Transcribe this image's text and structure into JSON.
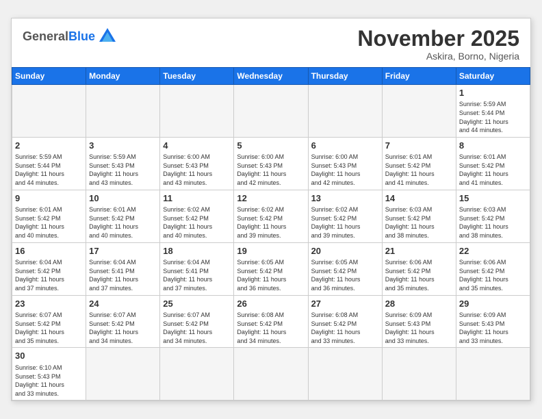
{
  "header": {
    "logo_general": "General",
    "logo_blue": "Blue",
    "month_title": "November 2025",
    "location": "Askira, Borno, Nigeria"
  },
  "weekdays": [
    "Sunday",
    "Monday",
    "Tuesday",
    "Wednesday",
    "Thursday",
    "Friday",
    "Saturday"
  ],
  "weeks": [
    [
      {
        "day": "",
        "info": ""
      },
      {
        "day": "",
        "info": ""
      },
      {
        "day": "",
        "info": ""
      },
      {
        "day": "",
        "info": ""
      },
      {
        "day": "",
        "info": ""
      },
      {
        "day": "",
        "info": ""
      },
      {
        "day": "1",
        "info": "Sunrise: 5:59 AM\nSunset: 5:44 PM\nDaylight: 11 hours\nand 44 minutes."
      }
    ],
    [
      {
        "day": "2",
        "info": "Sunrise: 5:59 AM\nSunset: 5:44 PM\nDaylight: 11 hours\nand 44 minutes."
      },
      {
        "day": "3",
        "info": "Sunrise: 5:59 AM\nSunset: 5:43 PM\nDaylight: 11 hours\nand 43 minutes."
      },
      {
        "day": "4",
        "info": "Sunrise: 6:00 AM\nSunset: 5:43 PM\nDaylight: 11 hours\nand 43 minutes."
      },
      {
        "day": "5",
        "info": "Sunrise: 6:00 AM\nSunset: 5:43 PM\nDaylight: 11 hours\nand 42 minutes."
      },
      {
        "day": "6",
        "info": "Sunrise: 6:00 AM\nSunset: 5:43 PM\nDaylight: 11 hours\nand 42 minutes."
      },
      {
        "day": "7",
        "info": "Sunrise: 6:01 AM\nSunset: 5:42 PM\nDaylight: 11 hours\nand 41 minutes."
      },
      {
        "day": "8",
        "info": "Sunrise: 6:01 AM\nSunset: 5:42 PM\nDaylight: 11 hours\nand 41 minutes."
      }
    ],
    [
      {
        "day": "9",
        "info": "Sunrise: 6:01 AM\nSunset: 5:42 PM\nDaylight: 11 hours\nand 40 minutes."
      },
      {
        "day": "10",
        "info": "Sunrise: 6:01 AM\nSunset: 5:42 PM\nDaylight: 11 hours\nand 40 minutes."
      },
      {
        "day": "11",
        "info": "Sunrise: 6:02 AM\nSunset: 5:42 PM\nDaylight: 11 hours\nand 40 minutes."
      },
      {
        "day": "12",
        "info": "Sunrise: 6:02 AM\nSunset: 5:42 PM\nDaylight: 11 hours\nand 39 minutes."
      },
      {
        "day": "13",
        "info": "Sunrise: 6:02 AM\nSunset: 5:42 PM\nDaylight: 11 hours\nand 39 minutes."
      },
      {
        "day": "14",
        "info": "Sunrise: 6:03 AM\nSunset: 5:42 PM\nDaylight: 11 hours\nand 38 minutes."
      },
      {
        "day": "15",
        "info": "Sunrise: 6:03 AM\nSunset: 5:42 PM\nDaylight: 11 hours\nand 38 minutes."
      }
    ],
    [
      {
        "day": "16",
        "info": "Sunrise: 6:04 AM\nSunset: 5:42 PM\nDaylight: 11 hours\nand 37 minutes."
      },
      {
        "day": "17",
        "info": "Sunrise: 6:04 AM\nSunset: 5:41 PM\nDaylight: 11 hours\nand 37 minutes."
      },
      {
        "day": "18",
        "info": "Sunrise: 6:04 AM\nSunset: 5:41 PM\nDaylight: 11 hours\nand 37 minutes."
      },
      {
        "day": "19",
        "info": "Sunrise: 6:05 AM\nSunset: 5:42 PM\nDaylight: 11 hours\nand 36 minutes."
      },
      {
        "day": "20",
        "info": "Sunrise: 6:05 AM\nSunset: 5:42 PM\nDaylight: 11 hours\nand 36 minutes."
      },
      {
        "day": "21",
        "info": "Sunrise: 6:06 AM\nSunset: 5:42 PM\nDaylight: 11 hours\nand 35 minutes."
      },
      {
        "day": "22",
        "info": "Sunrise: 6:06 AM\nSunset: 5:42 PM\nDaylight: 11 hours\nand 35 minutes."
      }
    ],
    [
      {
        "day": "23",
        "info": "Sunrise: 6:07 AM\nSunset: 5:42 PM\nDaylight: 11 hours\nand 35 minutes."
      },
      {
        "day": "24",
        "info": "Sunrise: 6:07 AM\nSunset: 5:42 PM\nDaylight: 11 hours\nand 34 minutes."
      },
      {
        "day": "25",
        "info": "Sunrise: 6:07 AM\nSunset: 5:42 PM\nDaylight: 11 hours\nand 34 minutes."
      },
      {
        "day": "26",
        "info": "Sunrise: 6:08 AM\nSunset: 5:42 PM\nDaylight: 11 hours\nand 34 minutes."
      },
      {
        "day": "27",
        "info": "Sunrise: 6:08 AM\nSunset: 5:42 PM\nDaylight: 11 hours\nand 33 minutes."
      },
      {
        "day": "28",
        "info": "Sunrise: 6:09 AM\nSunset: 5:43 PM\nDaylight: 11 hours\nand 33 minutes."
      },
      {
        "day": "29",
        "info": "Sunrise: 6:09 AM\nSunset: 5:43 PM\nDaylight: 11 hours\nand 33 minutes."
      }
    ],
    [
      {
        "day": "30",
        "info": "Sunrise: 6:10 AM\nSunset: 5:43 PM\nDaylight: 11 hours\nand 33 minutes."
      },
      {
        "day": "",
        "info": ""
      },
      {
        "day": "",
        "info": ""
      },
      {
        "day": "",
        "info": ""
      },
      {
        "day": "",
        "info": ""
      },
      {
        "day": "",
        "info": ""
      },
      {
        "day": "",
        "info": ""
      }
    ]
  ]
}
